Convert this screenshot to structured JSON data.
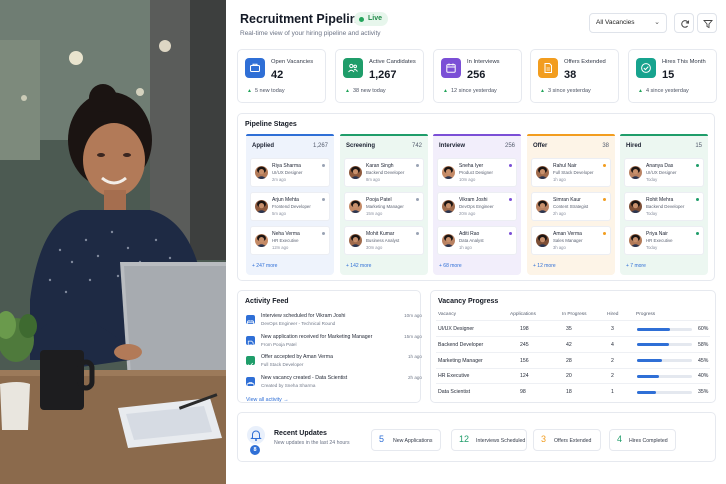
{
  "header": {
    "title": "Recruitment Pipeline",
    "live_badge": "Live",
    "subtitle": "Real-time view of your hiring pipeline and activity",
    "vacancy_filter": "All Vacancies"
  },
  "kpis": [
    {
      "label": "Open Vacancies",
      "value": "42",
      "delta": "5 new today",
      "icon": "briefcase-icon",
      "color": "#2f6fd6",
      "bg": "#2f6fd6"
    },
    {
      "label": "Active Candidates",
      "value": "1,267",
      "delta": "38 new today",
      "icon": "users-icon",
      "color": "#1f9d6a",
      "bg": "#1f9d6a"
    },
    {
      "label": "In Interviews",
      "value": "256",
      "delta": "12 since yesterday",
      "icon": "calendar-icon",
      "color": "#7b4fd6",
      "bg": "#7b4fd6"
    },
    {
      "label": "Offers Extended",
      "value": "38",
      "delta": "3 since yesterday",
      "icon": "document-icon",
      "color": "#f29d1f",
      "bg": "#f29d1f"
    },
    {
      "label": "Hires This Month",
      "value": "15",
      "delta": "4 since yesterday",
      "icon": "check-badge-icon",
      "color": "#17a38e",
      "bg": "#17a38e"
    }
  ],
  "pipeline": {
    "title": "Pipeline Stages",
    "stages": [
      {
        "name": "Applied",
        "count": "1,267",
        "color": "#2f6fd6",
        "bg": "#eef3fc",
        "more": "+ 247 more",
        "candidates": [
          {
            "name": "Riya Sharma",
            "role": "UI/UX Designer",
            "time": "2m ago",
            "dot": "#9aa3b4"
          },
          {
            "name": "Arjun Mehta",
            "role": "Frontend Developer",
            "time": "5m ago",
            "dot": "#9aa3b4"
          },
          {
            "name": "Neha Verma",
            "role": "HR Executive",
            "time": "12m ago",
            "dot": "#9aa3b4"
          }
        ]
      },
      {
        "name": "Screening",
        "count": "742",
        "color": "#1f9d6a",
        "bg": "#ecf7f1",
        "more": "+ 142 more",
        "candidates": [
          {
            "name": "Karan Singh",
            "role": "Backend Developer",
            "time": "8m ago",
            "dot": "#9aa3b4"
          },
          {
            "name": "Pooja Patel",
            "role": "Marketing Manager",
            "time": "15m ago",
            "dot": "#9aa3b4"
          },
          {
            "name": "Mohit Kumar",
            "role": "Business Analyst",
            "time": "30m ago",
            "dot": "#9aa3b4"
          }
        ]
      },
      {
        "name": "Interview",
        "count": "256",
        "color": "#7b4fd6",
        "bg": "#f2eefb",
        "more": "+ 68 more",
        "candidates": [
          {
            "name": "Sneha Iyer",
            "role": "Product Designer",
            "time": "10m ago",
            "dot": "#7b4fd6"
          },
          {
            "name": "Vikram Joshi",
            "role": "DevOps Engineer",
            "time": "20m ago",
            "dot": "#7b4fd6"
          },
          {
            "name": "Aditi Rao",
            "role": "Data Analyst",
            "time": "1h ago",
            "dot": "#7b4fd6"
          }
        ]
      },
      {
        "name": "Offer",
        "count": "38",
        "color": "#f29d1f",
        "bg": "#fdf4e7",
        "more": "+ 12 more",
        "candidates": [
          {
            "name": "Rahul Nair",
            "role": "Full Stack Developer",
            "time": "1h ago",
            "dot": "#f29d1f"
          },
          {
            "name": "Simran Kaur",
            "role": "Content Strategist",
            "time": "2h ago",
            "dot": "#f29d1f"
          },
          {
            "name": "Aman Verma",
            "role": "Sales Manager",
            "time": "3h ago",
            "dot": "#f29d1f"
          }
        ]
      },
      {
        "name": "Hired",
        "count": "15",
        "color": "#1f9d6a",
        "bg": "#ecf7f1",
        "more": "+ 7 more",
        "candidates": [
          {
            "name": "Ananya Das",
            "role": "UI/UX Designer",
            "time": "Today",
            "dot": "#1f9d6a"
          },
          {
            "name": "Rohit Mehra",
            "role": "Backend Developer",
            "time": "Today",
            "dot": "#1f9d6a"
          },
          {
            "name": "Priya Nair",
            "role": "HR Executive",
            "time": "Today",
            "dot": "#1f9d6a"
          }
        ]
      }
    ]
  },
  "activity": {
    "title": "Activity Feed",
    "view_all": "View all activity",
    "items": [
      {
        "text": "Interview scheduled for Vikram Joshi",
        "sub": "DevOps Engineer - Technical Round",
        "time": "10m ago",
        "icon": "calendar-icon",
        "color": "#2f6fd6"
      },
      {
        "text": "New application received for Marketing Manager",
        "sub": "From Pooja Patel",
        "time": "15m ago",
        "icon": "document-icon",
        "color": "#2f6fd6"
      },
      {
        "text": "Offer accepted by Aman Verma",
        "sub": "Full Stack Developer",
        "time": "1h ago",
        "icon": "check-icon",
        "color": "#1f9d6a"
      },
      {
        "text": "New vacancy created - Data Scientist",
        "sub": "Created by Sneha Sharma",
        "time": "2h ago",
        "icon": "briefcase-icon",
        "color": "#2f6fd6"
      }
    ]
  },
  "vacancy": {
    "title": "Vacancy Progress",
    "columns": [
      "Vacancy",
      "Applications",
      "In Progress",
      "Hired",
      "Progress"
    ],
    "rows": [
      {
        "vacancy": "UI/UX Designer",
        "applications": "198",
        "in_progress": "35",
        "hired": "3",
        "progress": 60,
        "progress_label": "60%"
      },
      {
        "vacancy": "Backend Developer",
        "applications": "245",
        "in_progress": "42",
        "hired": "4",
        "progress": 58,
        "progress_label": "58%"
      },
      {
        "vacancy": "Marketing Manager",
        "applications": "156",
        "in_progress": "28",
        "hired": "2",
        "progress": 45,
        "progress_label": "45%"
      },
      {
        "vacancy": "HR Executive",
        "applications": "124",
        "in_progress": "20",
        "hired": "2",
        "progress": 40,
        "progress_label": "40%"
      },
      {
        "vacancy": "Data Scientist",
        "applications": "98",
        "in_progress": "18",
        "hired": "1",
        "progress": 35,
        "progress_label": "35%"
      }
    ]
  },
  "recent_updates": {
    "title": "Recent Updates",
    "subtitle": "New updates in the last 24 hours",
    "badge": "8",
    "chips": [
      {
        "number": "5",
        "label": "New Applications",
        "color": "#2f6fd6"
      },
      {
        "number": "12",
        "label": "Interviews Scheduled",
        "color": "#1f9d6a"
      },
      {
        "number": "3",
        "label": "Offers Extended",
        "color": "#f29d1f"
      },
      {
        "number": "4",
        "label": "Hires Completed",
        "color": "#1f9d6a"
      }
    ]
  }
}
